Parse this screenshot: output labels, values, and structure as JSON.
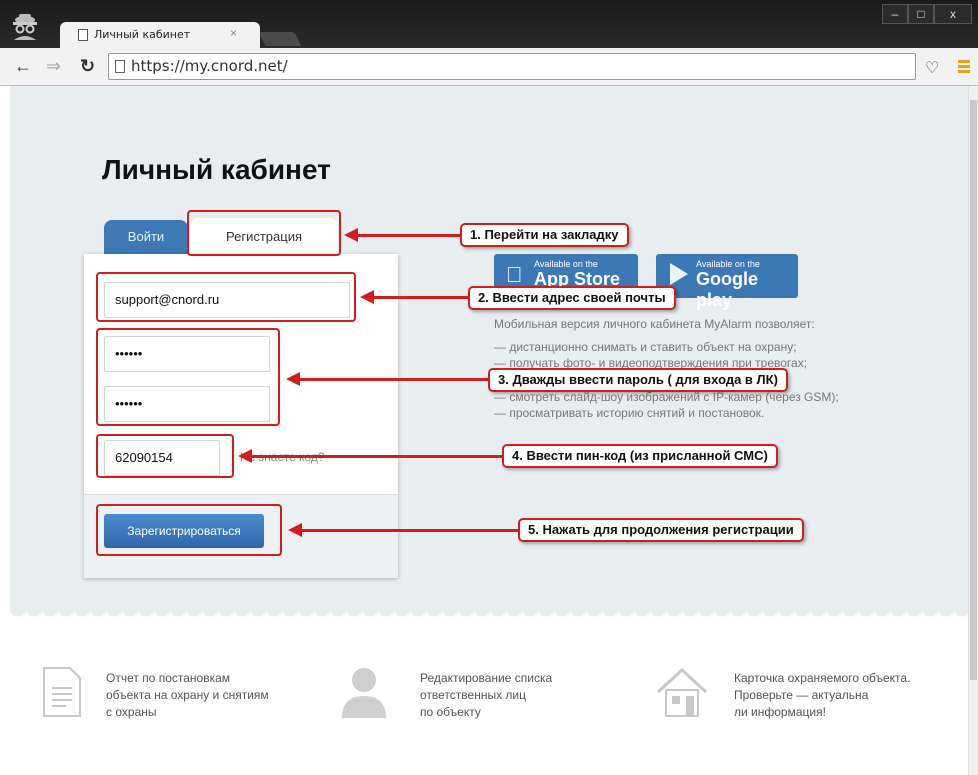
{
  "browser": {
    "tab_title": "Личный кабинет",
    "tab_close": "×",
    "url": "https://my.cnord.net/",
    "window_buttons": {
      "minimize": "–",
      "maximize": "□",
      "close": "x"
    }
  },
  "page": {
    "title": "Личный кабинет",
    "tabs": {
      "login": "Войти",
      "register": "Регистрация"
    },
    "form": {
      "email_value": "support@cnord.ru",
      "password_value": "••••••",
      "password_confirm_value": "••••••",
      "pin_value": "62090154",
      "forgot_code_link": "Не знаете код?",
      "register_button": "Зарегистрироваться"
    },
    "stores": {
      "apple_small": "Available on the",
      "apple_big": "App Store",
      "google_small": "Available on the",
      "google_big": "Google play"
    },
    "app_description": {
      "intro": "Мобильная версия личного кабинета MyAlarm позволяет:",
      "items": [
        "— дистанционно снимать и ставить объект на охрану;",
        "— получать фото- и видеоподтверждения при тревогах;",
        "— смотреть слайд-шоу изображений с IP-камер (через GSM);",
        "— просматривать историю снятий и постановок."
      ]
    },
    "features": [
      {
        "icon": "document-icon",
        "lines": [
          "Отчет по постановкам",
          "объекта на охрану и снятиям",
          "с охраны"
        ]
      },
      {
        "icon": "person-icon",
        "lines": [
          "Редактирование списка",
          "ответственных лиц",
          "по объекту"
        ]
      },
      {
        "icon": "house-icon",
        "lines": [
          "Карточка охраняемого объекта.",
          "Проверьте — актуальна",
          "ли информация!"
        ]
      }
    ]
  },
  "annotations": {
    "step1": "1. Перейти на закладку",
    "step2": "2. Ввести адрес своей почты",
    "step3": "3. Дважды ввести пароль ( для входа в ЛК)",
    "step4": "4. Ввести пин-код (из присланной СМС)",
    "step5": "5. Нажать для продолжения регистрации",
    "color": "#d21d1d"
  },
  "colors": {
    "accent": "#3e78b5",
    "page_bg": "#e8edf0"
  }
}
